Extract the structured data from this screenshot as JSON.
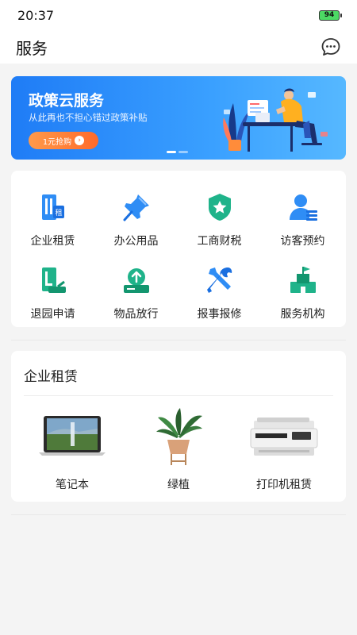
{
  "status_bar": {
    "time": "20:37",
    "battery": "94"
  },
  "header": {
    "title": "服务"
  },
  "banner": {
    "title": "政策云服务",
    "subtitle": "从此再也不担心错过政策补贴",
    "button_label": "1元抢购",
    "active_slide": 1,
    "slide_count": 2
  },
  "services": [
    {
      "label": "企业租赁",
      "icon": "lease-icon"
    },
    {
      "label": "办公用品",
      "icon": "pushpin-icon"
    },
    {
      "label": "工商财税",
      "icon": "badge-icon"
    },
    {
      "label": "访客预约",
      "icon": "visitor-icon"
    },
    {
      "label": "退园申请",
      "icon": "exit-icon"
    },
    {
      "label": "物品放行",
      "icon": "upload-tray-icon"
    },
    {
      "label": "报事报修",
      "icon": "tools-icon"
    },
    {
      "label": "服务机构",
      "icon": "institution-icon"
    }
  ],
  "rental": {
    "title": "企业租赁",
    "items": [
      {
        "label": "笔记本"
      },
      {
        "label": "绿植"
      },
      {
        "label": "打印机租赁"
      }
    ]
  },
  "colors": {
    "primary": "#1f7cf6",
    "accent_orange": "#ff6a2a",
    "icon_blue": "#2f8df5",
    "icon_green": "#1fb38a"
  }
}
